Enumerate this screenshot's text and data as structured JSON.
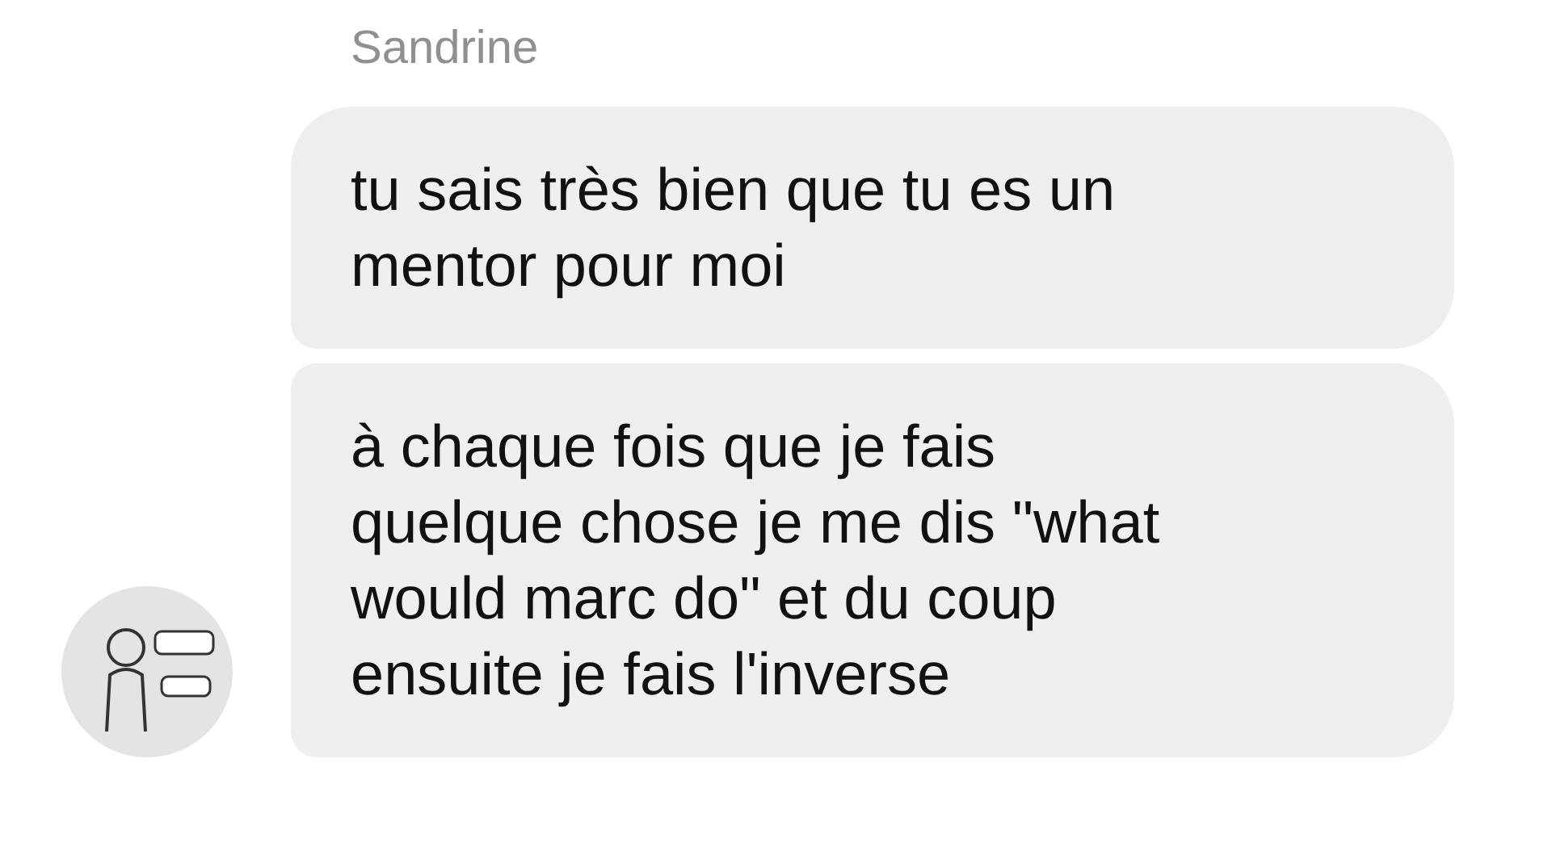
{
  "sender": {
    "name": "Sandrine"
  },
  "messages": [
    {
      "text": "tu sais très bien que tu es un\nmentor pour moi"
    },
    {
      "text": "à chaque fois que je fais\nquelque chose je me dis \"what\nwould marc do\" et du coup\nensuite je fais l'inverse"
    }
  ]
}
